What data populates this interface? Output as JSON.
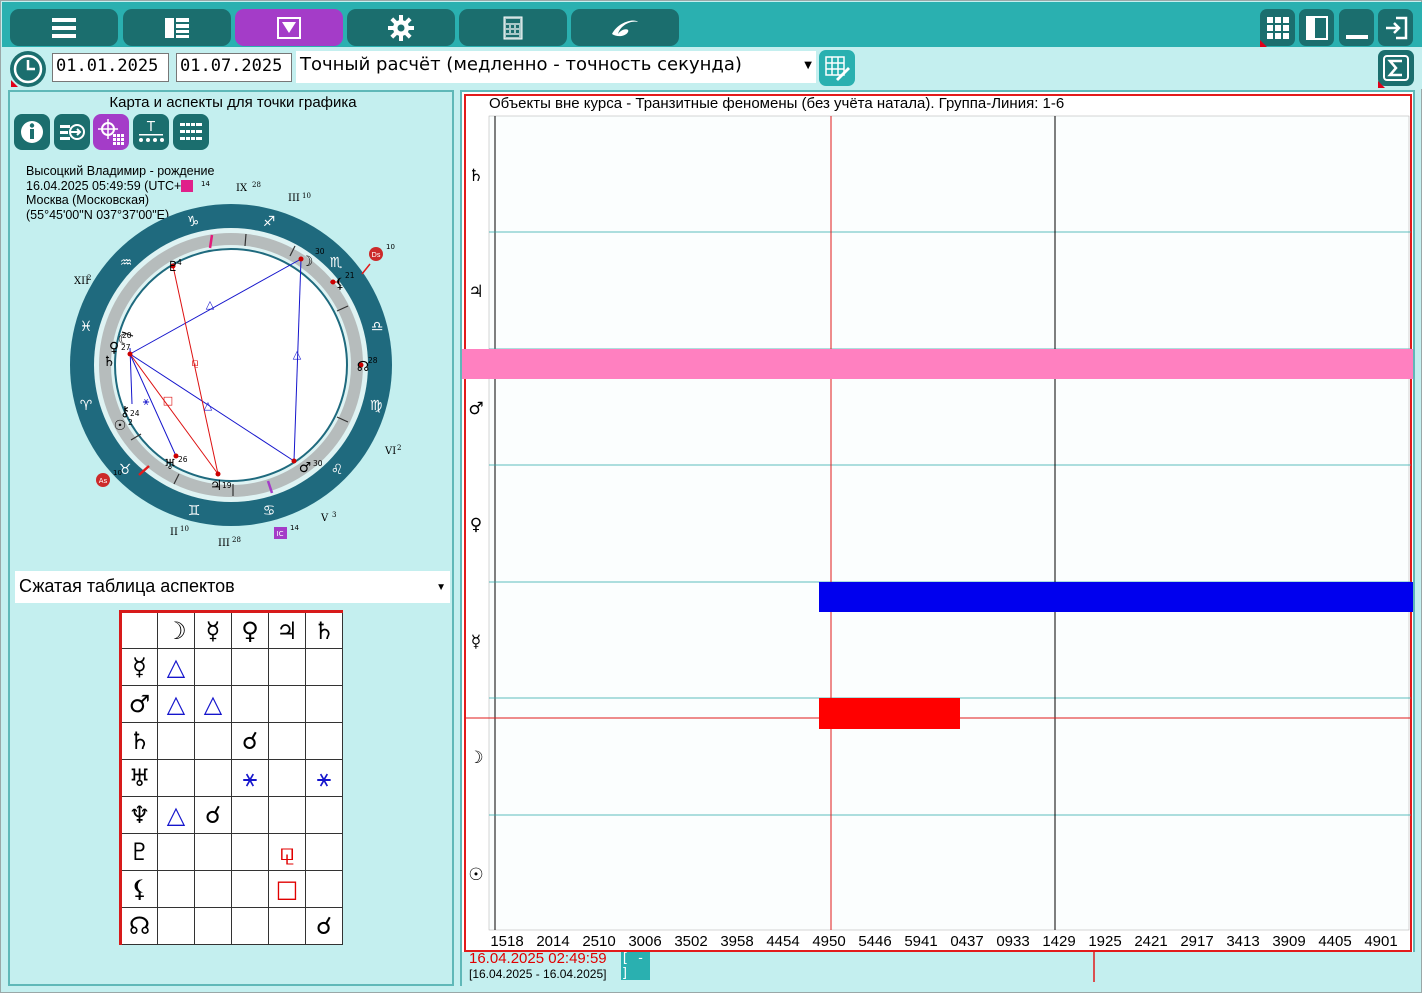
{
  "toolbar": {
    "buttons": [
      "list-icon",
      "layout-icon",
      "filter-icon",
      "gear-icon",
      "calculator-icon",
      "logo-icon"
    ],
    "right_buttons": [
      "grid-icon",
      "panel-icon",
      "minimize-icon",
      "exit-icon"
    ]
  },
  "dates": {
    "start": "01.01.2025",
    "end": "01.07.2025"
  },
  "calc_mode": "Точный расчёт (медленно - точность секунда)",
  "left_panel": {
    "title": "Карта и аспекты для точки графика",
    "info_name": "Высоцкий Владимир - рождение",
    "info_datetime": "16.04.2025 05:49:59 (UTC+",
    "info_city": "Москва (Московская)",
    "info_coords": "(55°45'00\"N 037°37'00\"E)",
    "aspect_table_mode": "Сжатая таблица аспектов"
  },
  "aspect_table": {
    "header": [
      "☽",
      "☿",
      "♀",
      "♃",
      "♄"
    ],
    "rows": [
      {
        "planet": "☿",
        "cells": [
          "△",
          "",
          "",
          "",
          ""
        ]
      },
      {
        "planet": "♂",
        "cells": [
          "△",
          "△",
          "",
          "",
          ""
        ]
      },
      {
        "planet": "♄",
        "cells": [
          "",
          "",
          "☌",
          "",
          ""
        ]
      },
      {
        "planet": "♅",
        "cells": [
          "",
          "",
          "⚹",
          "",
          "⚹"
        ]
      },
      {
        "planet": "♆",
        "cells": [
          "△",
          "☌",
          "",
          "",
          ""
        ]
      },
      {
        "planet": "♇",
        "cells": [
          "",
          "",
          "",
          "⚼",
          ""
        ]
      },
      {
        "planet": "⚸",
        "cells": [
          "",
          "",
          "",
          "□",
          ""
        ]
      },
      {
        "planet": "☊",
        "cells": [
          "",
          "",
          "",
          "",
          "☌"
        ]
      }
    ]
  },
  "graph": {
    "title": "Объекты вне курса - Транзитные феномены (без учёта натала). Группа-Линия: 1-6",
    "rows": [
      "♄",
      "♃",
      "♂",
      "♀",
      "☿",
      "☽",
      "☉"
    ],
    "x_labels": [
      "1518",
      "2014",
      "2510",
      "3006",
      "3502",
      "3958",
      "4454",
      "4950",
      "5446",
      "5941",
      "0437",
      "0933",
      "1429",
      "1925",
      "2421",
      "2917",
      "3413",
      "3909",
      "4405",
      "4901"
    ],
    "status_datetime": "16.04.2025 02:49:59",
    "status_range": "[16.04.2025 - 16.04.2025]",
    "minus_label": "[ - ]"
  },
  "colors": {
    "teal": "#2ab0b0",
    "dark_teal": "#1b6e6e",
    "purple": "#a43cc8",
    "pink_bar": "#ff80c0",
    "blue_bar": "#0000ee",
    "red_bar": "#ff0000"
  }
}
